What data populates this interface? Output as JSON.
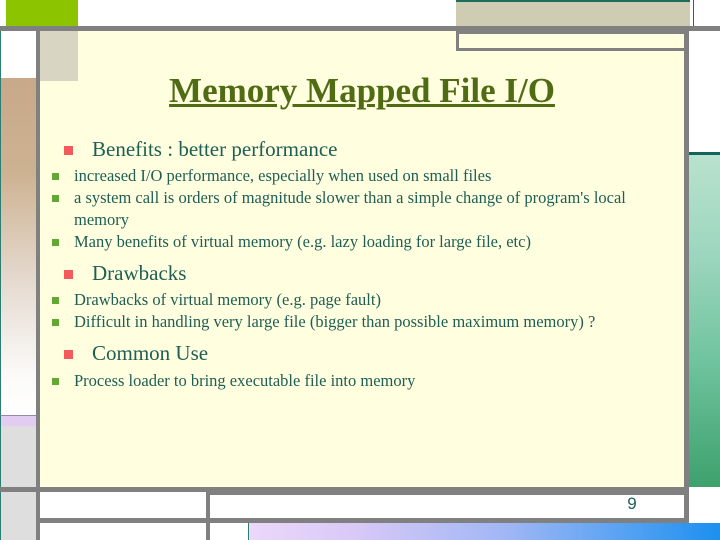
{
  "slide": {
    "title": "Memory Mapped File I/O",
    "page_number": "9",
    "colors": {
      "background": "#FFFFE0",
      "title_text": "#4F6B14",
      "body_text": "#1E5E55",
      "level1_bullet": "#F4595C",
      "level2_bullet": "#63A832",
      "frame_rule": "#808080",
      "accent_lime": "#8CC400",
      "accent_beige": "#CFCCB4",
      "accent_teal": "#1F6B5C",
      "left_rail_tan": "#C8A98A",
      "left_rail_lavender": "#E2CCF2",
      "left_rail_grey": "#DEDEDE",
      "right_rail_green_top": "#B9E2CE",
      "right_rail_green_bottom": "#3CA06B",
      "bottom_strip_start": "#EBD8FA",
      "bottom_strip_end": "#1C8FEF"
    },
    "outline": [
      {
        "level1": "Benefits : better performance",
        "level2": [
          "increased I/O performance, especially when used   on small files",
          "a system call is orders of magnitude slower than a  simple change of program's local memory",
          "Many benefits of virtual memory (e.g. lazy loading for large file, etc)"
        ]
      },
      {
        "level1": "Drawbacks",
        "level2": [
          "Drawbacks of virtual memory (e.g. page fault)",
          "Difficult in handling very large file (bigger than possible maximum memory) ?"
        ]
      },
      {
        "level1": "Common Use",
        "level2": [
          "Process loader to bring executable file into memory"
        ]
      }
    ]
  }
}
